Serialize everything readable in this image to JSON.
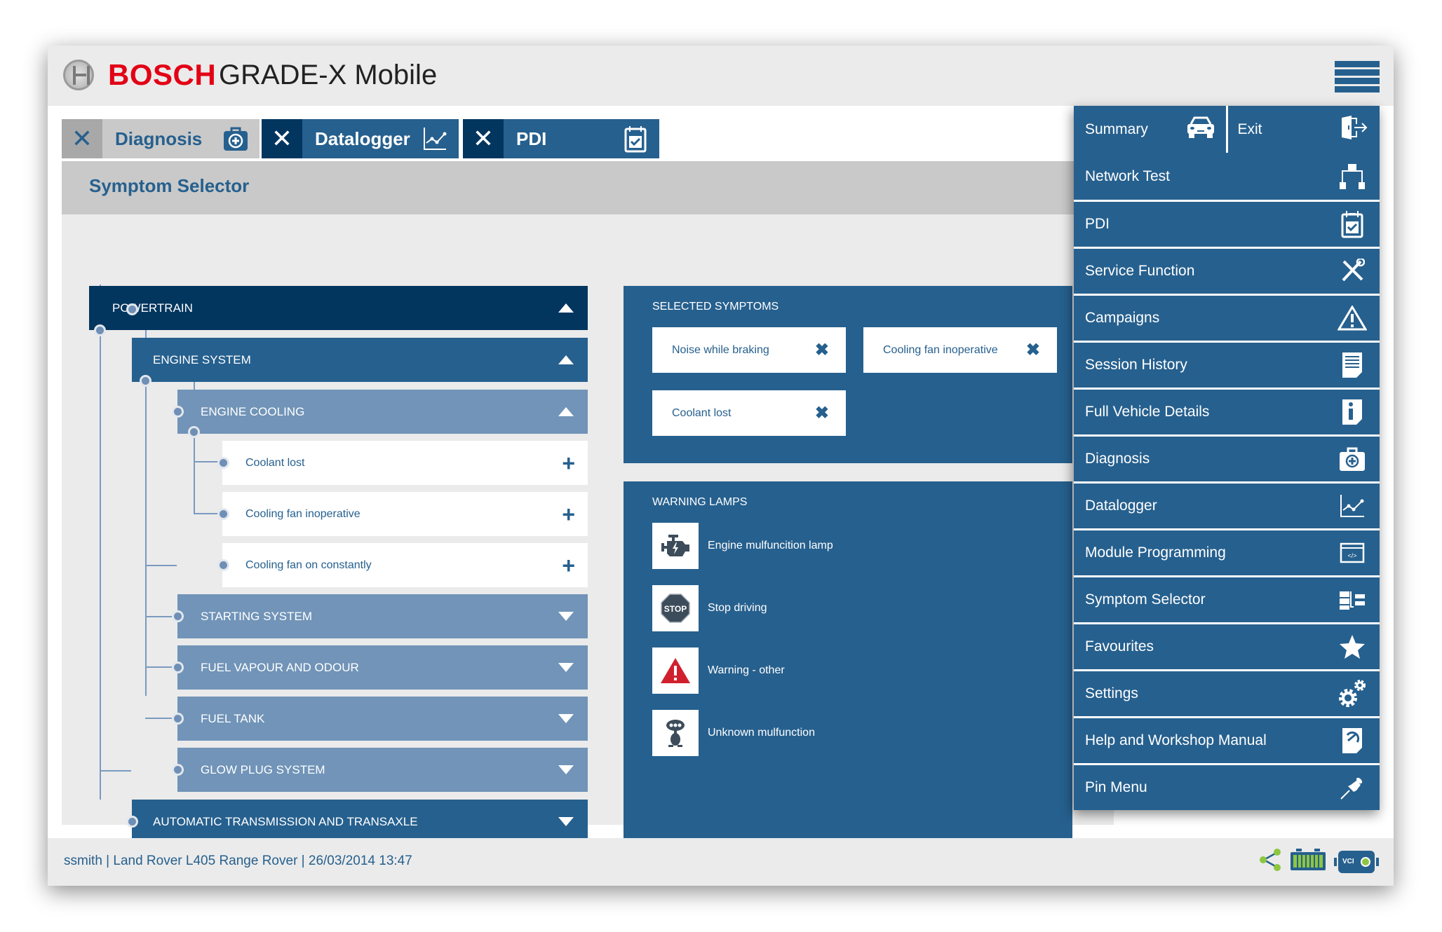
{
  "header": {
    "brand": "BOSCH",
    "app_title": "GRADE-X Mobile"
  },
  "tabs": [
    {
      "label": "Diagnosis",
      "icon": "medical-kit-icon",
      "active": true
    },
    {
      "label": "Datalogger",
      "icon": "line-chart-icon",
      "active": false
    },
    {
      "label": "PDI",
      "icon": "calendar-check-icon",
      "active": false
    }
  ],
  "page": {
    "title": "Symptom Selector"
  },
  "tree": {
    "powertrain": "POWERTRAIN",
    "engine_system": "ENGINE SYSTEM",
    "engine_cooling": "ENGINE COOLING",
    "leaves": [
      "Coolant lost",
      "Cooling fan inoperative",
      "Cooling fan on constantly"
    ],
    "subsystems": [
      "STARTING SYSTEM",
      "FUEL VAPOUR AND ODOUR",
      "FUEL TANK",
      "GLOW PLUG SYSTEM"
    ],
    "transmission": "AUTOMATIC TRANSMISSION AND TRANSAXLE"
  },
  "selected_symptoms": {
    "title": "SELECTED SYMPTOMS",
    "items": [
      "Noise while braking",
      "Cooling fan inoperative",
      "Coolant lost"
    ]
  },
  "warning_lamps": {
    "title": "WARNING LAMPS",
    "items": [
      {
        "label": "Engine mulfuncition lamp",
        "icon": "engine-icon"
      },
      {
        "label": "Stop driving",
        "icon": "stop-sign-icon",
        "icon_text": "STOP"
      },
      {
        "label": "Warning - other",
        "icon": "warning-triangle-icon"
      },
      {
        "label": "Unknown mulfunction",
        "icon": "robot-icon"
      }
    ]
  },
  "menu": {
    "summary": "Summary",
    "exit": "Exit",
    "items": [
      {
        "label": "Network Test",
        "icon": "network-icon"
      },
      {
        "label": "PDI",
        "icon": "calendar-check-icon"
      },
      {
        "label": "Service Function",
        "icon": "tools-icon"
      },
      {
        "label": "Campaigns",
        "icon": "warning-icon"
      },
      {
        "label": "Session History",
        "icon": "document-icon"
      },
      {
        "label": "Full Vehicle Details",
        "icon": "info-icon"
      },
      {
        "label": "Diagnosis",
        "icon": "medical-kit-icon"
      },
      {
        "label": "Datalogger",
        "icon": "line-chart-icon"
      },
      {
        "label": "Module Programming",
        "icon": "code-window-icon"
      },
      {
        "label": "Symptom Selector",
        "icon": "symptom-list-icon"
      },
      {
        "label": "Favourites",
        "icon": "star-icon"
      },
      {
        "label": "Settings",
        "icon": "gears-icon"
      },
      {
        "label": "Help and Workshop Manual",
        "icon": "manual-icon"
      },
      {
        "label": "Pin Menu",
        "icon": "pin-icon"
      }
    ]
  },
  "footer": {
    "status": "ssmith |  Land Rover L405 Range Rover | 26/03/2014 13:47",
    "vci_label": "VCI",
    "battery_level": 1.0
  },
  "colors": {
    "primary": "#26608e",
    "dark": "#03365f",
    "light": "#7194b8",
    "brand_red": "#e20015",
    "status_green": "#8dc63f"
  }
}
